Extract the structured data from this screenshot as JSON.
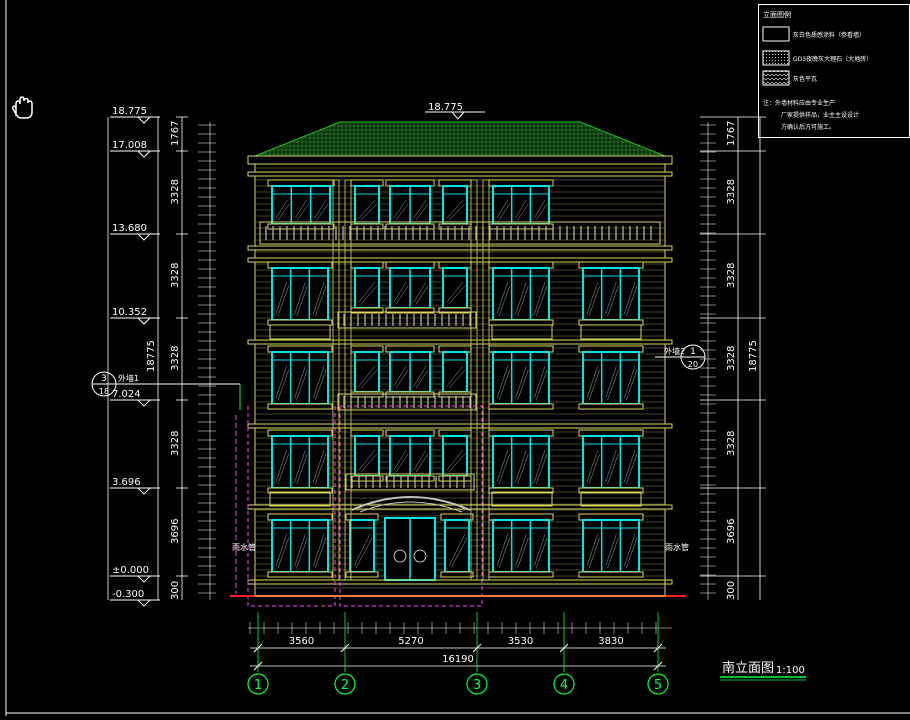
{
  "colors": {
    "background": "#000000",
    "building_line": "#d8d860",
    "window_frame": "#00e5e5",
    "dimension": "#ffffff",
    "axis": "#00ff40",
    "red_ground": "#ff2020",
    "magenta": "#ff40ff",
    "roof": "#20b020"
  },
  "cursor_icon": "hand-pointer-icon",
  "top_elevation": "18.775",
  "left_levels": [
    "18.775",
    "17.008",
    "13.680",
    "10.352",
    "7.024",
    "3.696",
    "±0.000",
    "-0.300"
  ],
  "left_segments": [
    "1767",
    "3328",
    "3328",
    "3328",
    "3328",
    "3696",
    "300"
  ],
  "left_total": "18775",
  "right_segments": [
    "1767",
    "3328",
    "3328",
    "3328",
    "3328",
    "3696",
    "300"
  ],
  "right_total": "18775",
  "callouts": {
    "left": {
      "num": "3",
      "sheet": "18",
      "label": "外墙1"
    },
    "right": {
      "num": "1",
      "sheet": "20",
      "label": "外墙2"
    }
  },
  "labels": {
    "downpipe_left": "雨水管",
    "downpipe_right": "雨水管"
  },
  "bottom_dims": [
    "3560",
    "5270",
    "3530",
    "3830"
  ],
  "bottom_total": "16190",
  "axis_numbers": [
    "1",
    "2",
    "3",
    "4",
    "5"
  ],
  "title": "南立面图",
  "scale": "1:100",
  "legend": {
    "heading": "立面图例",
    "items": [
      {
        "text": "灰白色质感涂料（参看墙）",
        "pattern": "blank"
      },
      {
        "text": "GD3夜晚灰大理石（大地砖）",
        "pattern": "dots"
      },
      {
        "text": "灰色平瓦",
        "pattern": "tile"
      }
    ],
    "note_title": "注：",
    "notes": [
      "外墙材料应由专业生产",
      "厂家提供样品，业主主设设计",
      "方确认后方可施工。"
    ]
  }
}
